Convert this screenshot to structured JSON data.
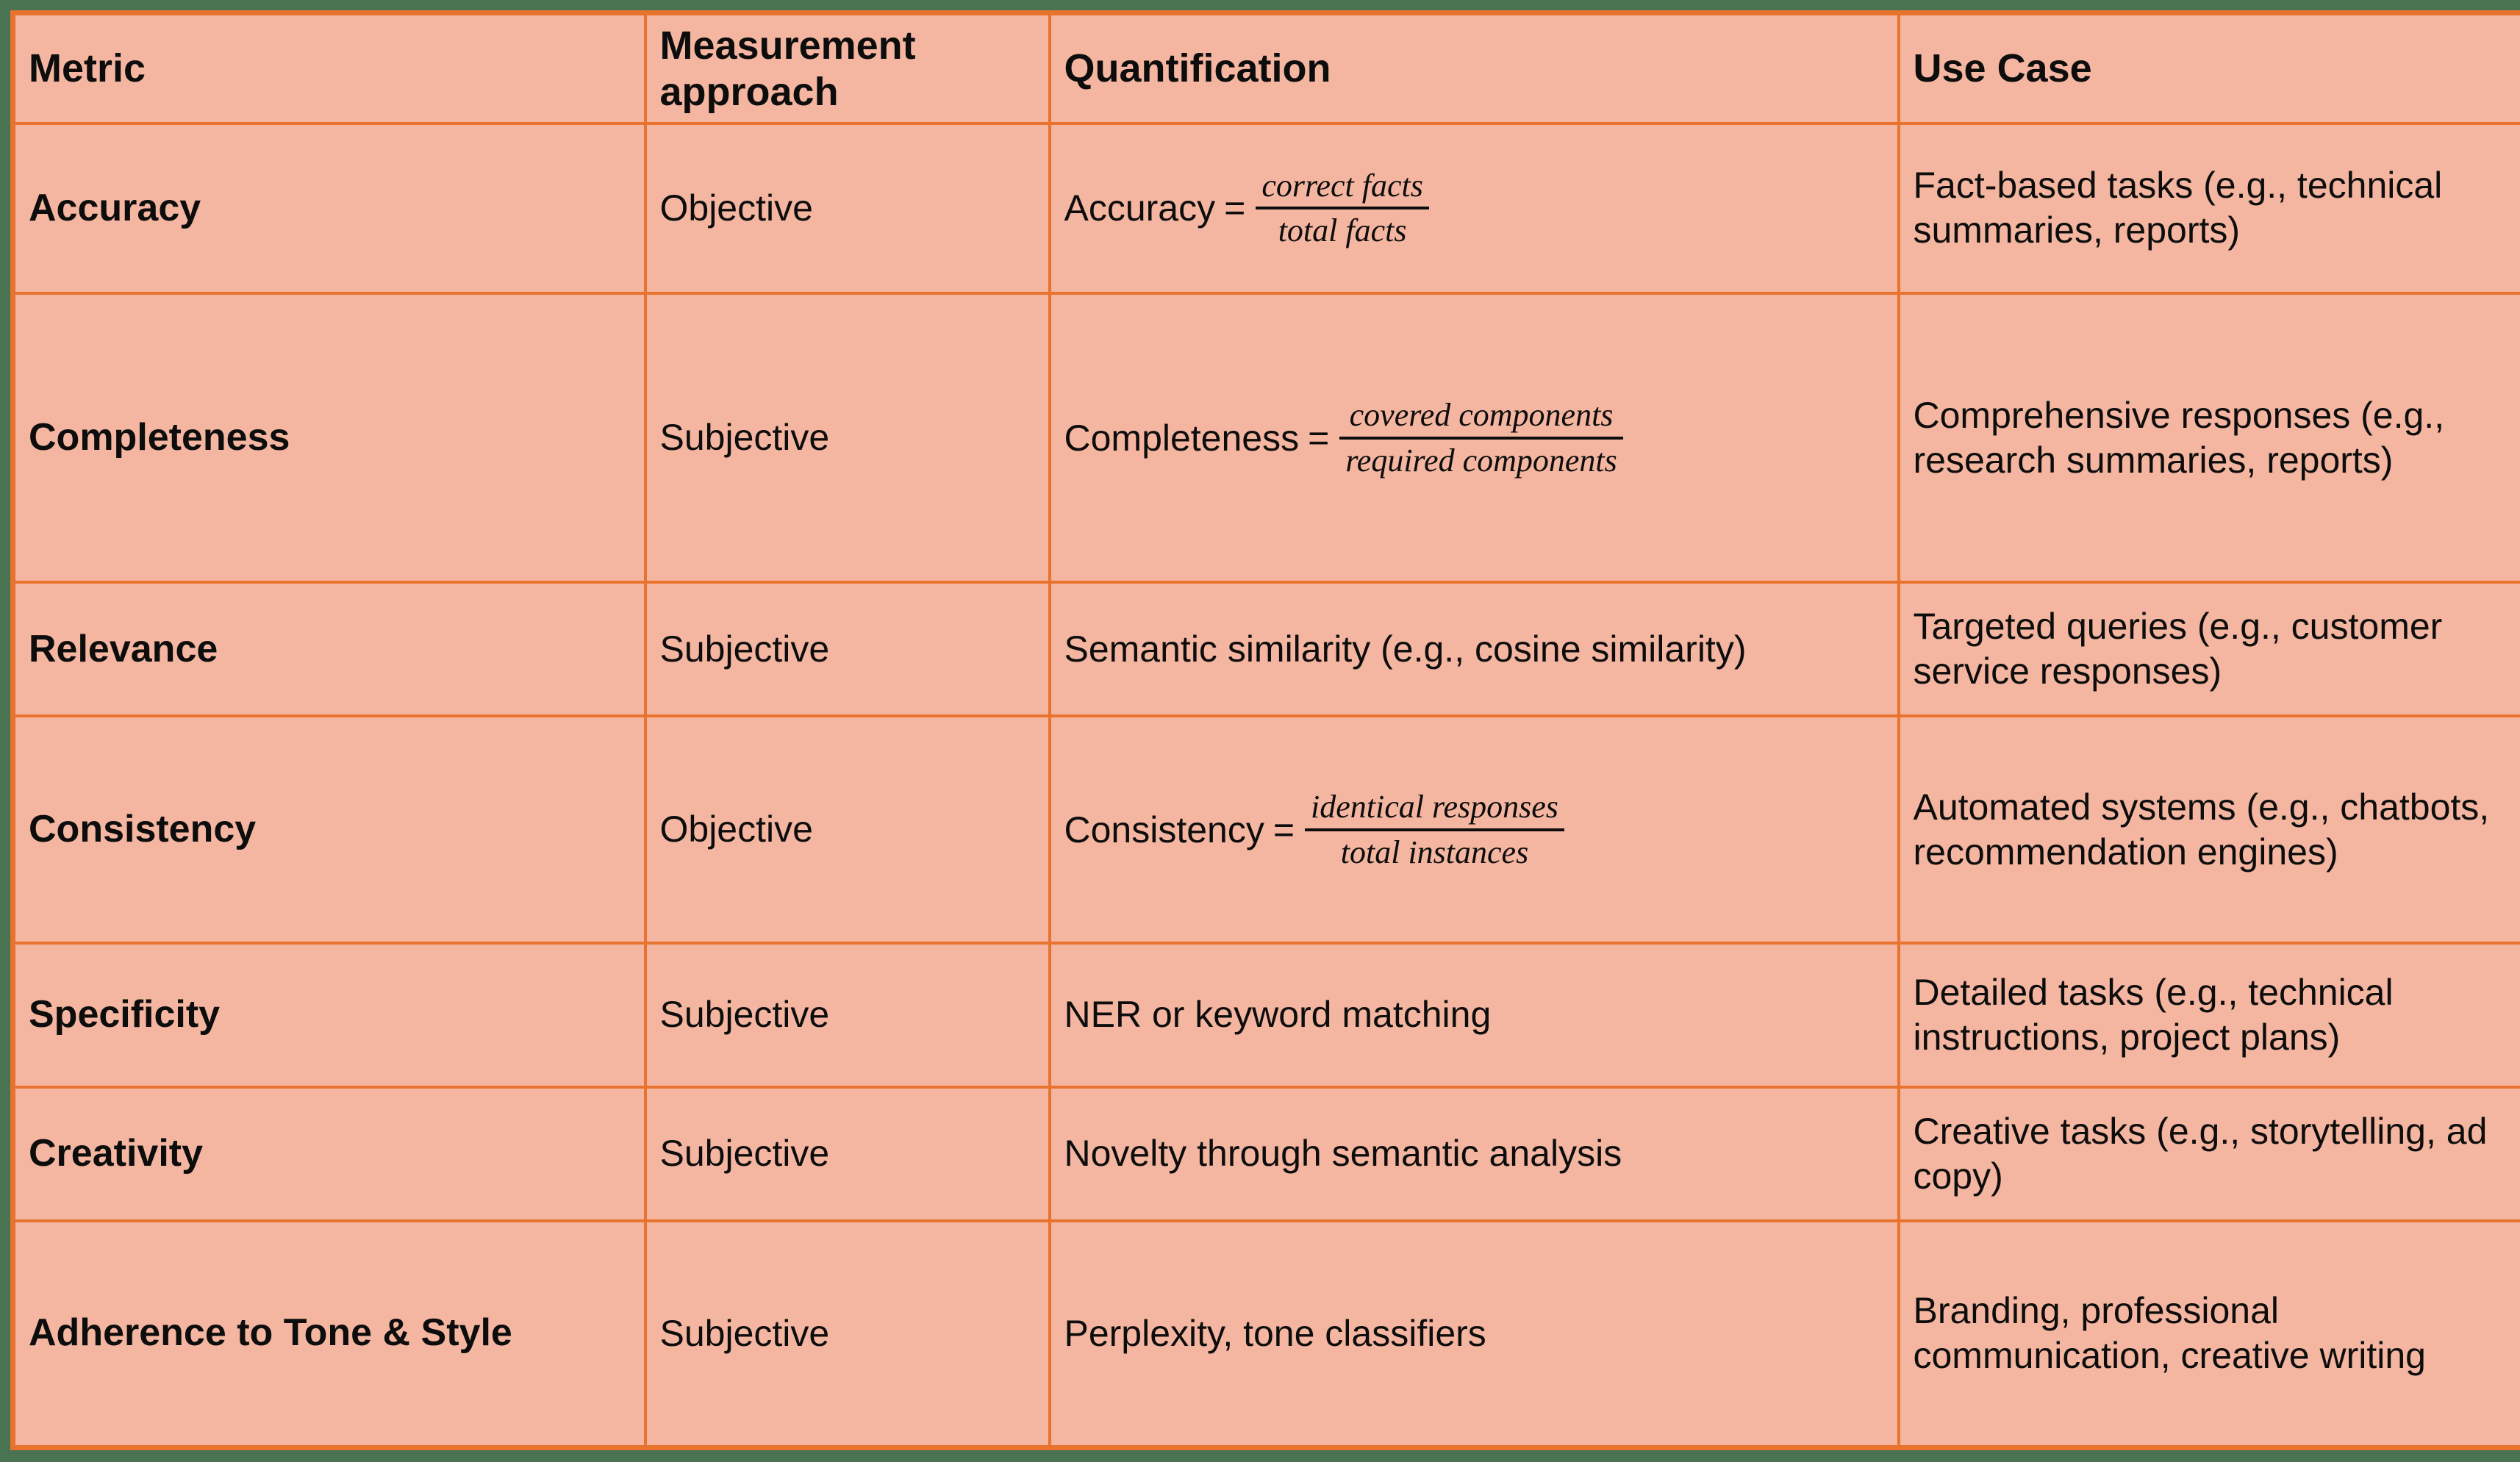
{
  "table": {
    "headers": [
      "Metric",
      "Measurement approach",
      "Quantification",
      "Use Case"
    ],
    "rows": [
      {
        "metric": "Accuracy",
        "approach": "Objective",
        "quantification": {
          "kind": "formula",
          "lhs": "Accuracy",
          "operator": "=",
          "numerator": "correct facts",
          "denominator": "total facts",
          "text": "Accuracy = correct facts / total facts"
        },
        "use_case": "Fact-based tasks (e.g., technical summaries, reports)"
      },
      {
        "metric": "Completeness",
        "approach": "Subjective",
        "quantification": {
          "kind": "formula",
          "lhs": "Completeness",
          "operator": "=",
          "numerator": "covered components",
          "denominator": "required components",
          "text": "Completeness = covered components / required components"
        },
        "use_case": "Comprehensive responses (e.g., research summaries, reports)"
      },
      {
        "metric": "Relevance",
        "approach": "Subjective",
        "quantification": {
          "kind": "text",
          "text": "Semantic similarity (e.g., cosine similarity)"
        },
        "use_case": "Targeted queries (e.g., customer service responses)"
      },
      {
        "metric": "Consistency",
        "approach": "Objective",
        "quantification": {
          "kind": "formula",
          "lhs": "Consistency",
          "operator": "=",
          "numerator": "identical responses",
          "denominator": "total instances",
          "text": "Consistency = identical responses / total instances"
        },
        "use_case": "Automated systems (e.g., chatbots, recommendation engines)"
      },
      {
        "metric": "Specificity",
        "approach": "Subjective",
        "quantification": {
          "kind": "text",
          "text": "NER or keyword matching"
        },
        "use_case": "Detailed tasks (e.g., technical instructions, project plans)"
      },
      {
        "metric": "Creativity",
        "approach": "Subjective",
        "quantification": {
          "kind": "text",
          "text": "Novelty through semantic analysis"
        },
        "use_case": "Creative tasks (e.g., storytelling, ad copy)"
      },
      {
        "metric": "Adherence to Tone & Style",
        "approach": "Subjective",
        "quantification": {
          "kind": "text",
          "text": "Perplexity, tone classifiers"
        },
        "use_case": "Branding, professional communication, creative writing"
      }
    ]
  },
  "colors": {
    "slide_background": "#4a7352",
    "table_border": "#e8732e",
    "cell_background": "#f4b6a0",
    "text": "#0d0d0d"
  }
}
